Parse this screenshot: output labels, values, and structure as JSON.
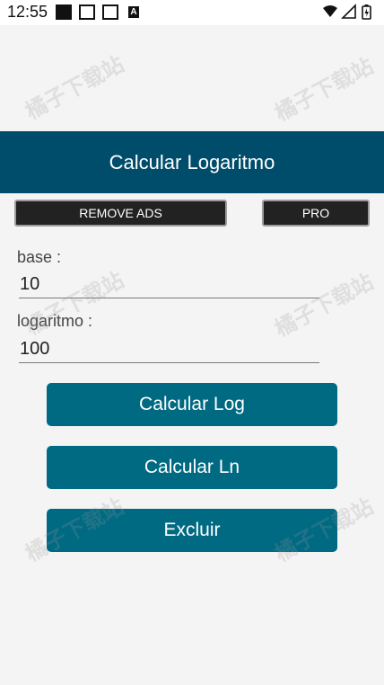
{
  "status_bar": {
    "time": "12:55",
    "notification_a": "A"
  },
  "app_bar": {
    "title": "Calcular Logaritmo"
  },
  "top_buttons": {
    "remove_ads": "REMOVE ADS",
    "pro": "PRO"
  },
  "form": {
    "base_label": "base :",
    "base_value": "10",
    "log_label": "logaritmo :",
    "log_value": "100"
  },
  "actions": {
    "calc_log": "Calcular Log",
    "calc_ln": "Calcular Ln",
    "delete": "Excluir"
  },
  "watermark": {
    "text": "橘子下载站"
  },
  "colors": {
    "app_bar": "#004d6b",
    "action_button": "#006a83",
    "small_button": "#222222",
    "background": "#f4f4f4"
  }
}
